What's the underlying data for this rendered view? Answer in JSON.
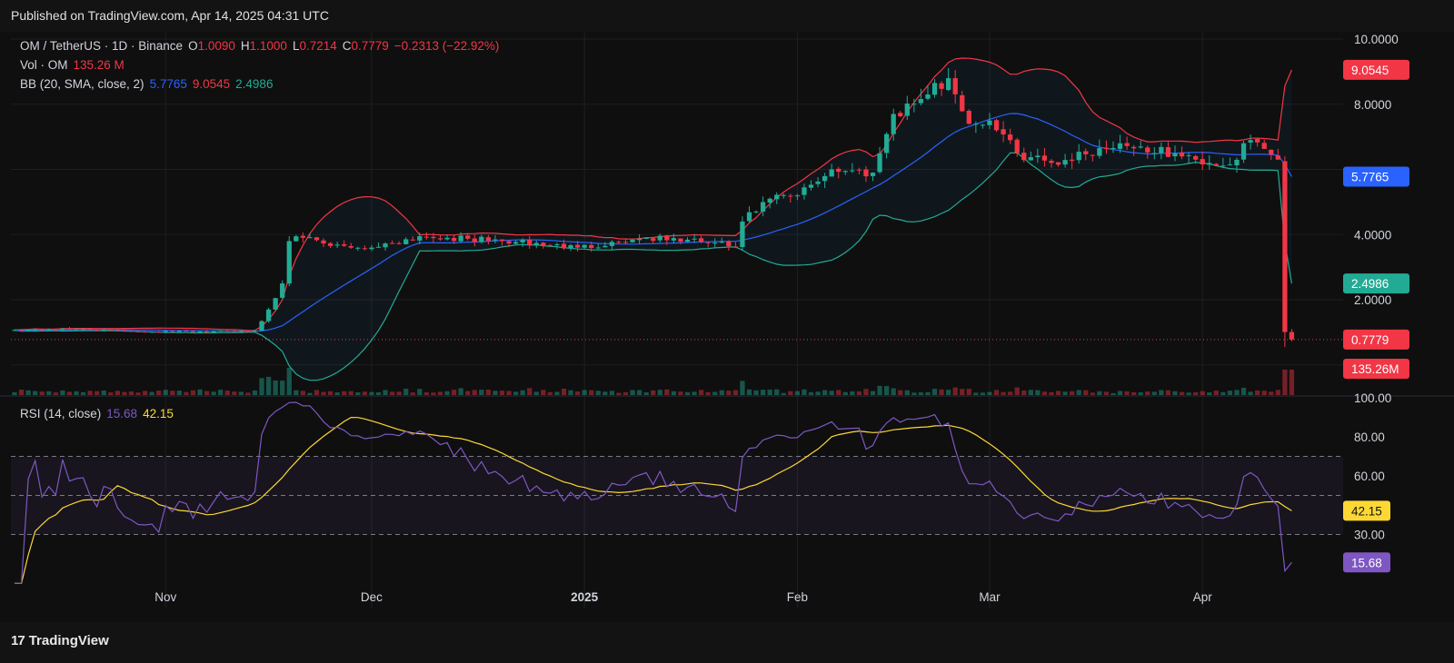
{
  "header": {
    "published": "Published on TradingView.com, Apr 14, 2025 04:31 UTC"
  },
  "legend": {
    "symbol": "OM / TetherUS · 1D · Binance",
    "o_label": "O",
    "o_value": "1.0090",
    "h_label": "H",
    "h_value": "1.1000",
    "l_label": "L",
    "l_value": "0.7214",
    "c_label": "C",
    "c_value": "0.7779",
    "change": "−0.2313 (−22.92%)",
    "vol_label": "Vol · OM",
    "vol_value": "135.26 M",
    "bb_label": "BB (20, SMA, close, 2)",
    "bb_basis": "5.7765",
    "bb_upper": "9.0545",
    "bb_lower": "2.4986",
    "rsi_label": "RSI (14, close)",
    "rsi_value": "15.68",
    "rsi_ma_value": "42.15"
  },
  "footer": {
    "brand_logo": "17",
    "brand_name": "TradingView"
  },
  "colors": {
    "up": "#22ab94",
    "down": "#f23645",
    "bb_basis": "#2962ff",
    "bb_upper": "#f23645",
    "bb_lower": "#22ab94",
    "rsi": "#7e57c2",
    "rsi_ma": "#fdd835",
    "background": "#131313"
  },
  "chart_data": {
    "type": "candlestick",
    "instrument": "OM / TetherUS",
    "interval": "1D",
    "exchange": "Binance",
    "price_axis_ticks": [
      "10.0000",
      "8.0000",
      "4.0000",
      "2.0000"
    ],
    "price_axis_values": [
      10,
      8,
      4,
      2
    ],
    "price_labels": [
      {
        "text": "9.0545",
        "value": 9.0545,
        "color": "#f23645"
      },
      {
        "text": "5.7765",
        "value": 5.7765,
        "color": "#2962ff"
      },
      {
        "text": "2.4986",
        "value": 2.4986,
        "color": "#22ab94"
      },
      {
        "text": "0.7779",
        "value": 0.7779,
        "color": "#f23645"
      },
      {
        "text": "135.26M",
        "value": 0.1,
        "color": "#f23645"
      }
    ],
    "x_labels": [
      {
        "text": "Nov",
        "date": "2024-11-01"
      },
      {
        "text": "Dec",
        "date": "2024-12-01"
      },
      {
        "text": "2025",
        "date": "2025-01-01"
      },
      {
        "text": "Feb",
        "date": "2025-02-01"
      },
      {
        "text": "Mar",
        "date": "2025-03-01"
      },
      {
        "text": "Apr",
        "date": "2025-04-01"
      }
    ],
    "date_range": [
      "2024-10-10",
      "2025-04-14"
    ],
    "last_close": 0.7779,
    "price_anchors": [
      {
        "date": "2024-10-10",
        "close": 1.07
      },
      {
        "date": "2024-10-20",
        "close": 1.1
      },
      {
        "date": "2024-10-30",
        "close": 1.02
      },
      {
        "date": "2024-11-08",
        "close": 1.03
      },
      {
        "date": "2024-11-14",
        "close": 1.05
      },
      {
        "date": "2024-11-16",
        "close": 1.7
      },
      {
        "date": "2024-11-18",
        "close": 2.5
      },
      {
        "date": "2024-11-19",
        "close": 3.8
      },
      {
        "date": "2024-11-21",
        "close": 3.9
      },
      {
        "date": "2024-11-25",
        "close": 3.65
      },
      {
        "date": "2024-12-01",
        "close": 3.6
      },
      {
        "date": "2024-12-08",
        "close": 3.95
      },
      {
        "date": "2024-12-12",
        "close": 3.9
      },
      {
        "date": "2024-12-20",
        "close": 3.8
      },
      {
        "date": "2024-12-31",
        "close": 3.6
      },
      {
        "date": "2025-01-10",
        "close": 3.9
      },
      {
        "date": "2025-01-20",
        "close": 3.75
      },
      {
        "date": "2025-01-23",
        "close": 3.6
      },
      {
        "date": "2025-01-24",
        "close": 4.4
      },
      {
        "date": "2025-01-28",
        "close": 5.1
      },
      {
        "date": "2025-02-01",
        "close": 5.2
      },
      {
        "date": "2025-02-06",
        "close": 6.0
      },
      {
        "date": "2025-02-12",
        "close": 5.9
      },
      {
        "date": "2025-02-15",
        "close": 7.7
      },
      {
        "date": "2025-02-20",
        "close": 8.3
      },
      {
        "date": "2025-02-23",
        "close": 8.8
      },
      {
        "date": "2025-02-26",
        "close": 7.4
      },
      {
        "date": "2025-03-01",
        "close": 7.5
      },
      {
        "date": "2025-03-05",
        "close": 6.5
      },
      {
        "date": "2025-03-10",
        "close": 6.2
      },
      {
        "date": "2025-03-20",
        "close": 6.8
      },
      {
        "date": "2025-03-31",
        "close": 6.3
      },
      {
        "date": "2025-04-05",
        "close": 6.15
      },
      {
        "date": "2025-04-08",
        "close": 6.9
      },
      {
        "date": "2025-04-12",
        "close": 6.3
      },
      {
        "date": "2025-04-13",
        "close": 1.009
      },
      {
        "date": "2025-04-14",
        "close": 0.7779
      }
    ],
    "bollinger": {
      "period": 20,
      "ma": "SMA",
      "source": "close",
      "mult": 2,
      "last_basis": 5.7765,
      "last_upper": 9.0545,
      "last_lower": 2.4986
    },
    "volume": {
      "last": "135.26M"
    },
    "rsi": {
      "period": 14,
      "last": 15.68,
      "last_ma": 42.15,
      "axis_ticks": [
        "100.00",
        "80.00",
        "60.00",
        "30.00"
      ],
      "axis_values": [
        100,
        80,
        60,
        30
      ],
      "bands": [
        70,
        50,
        30
      ]
    }
  }
}
